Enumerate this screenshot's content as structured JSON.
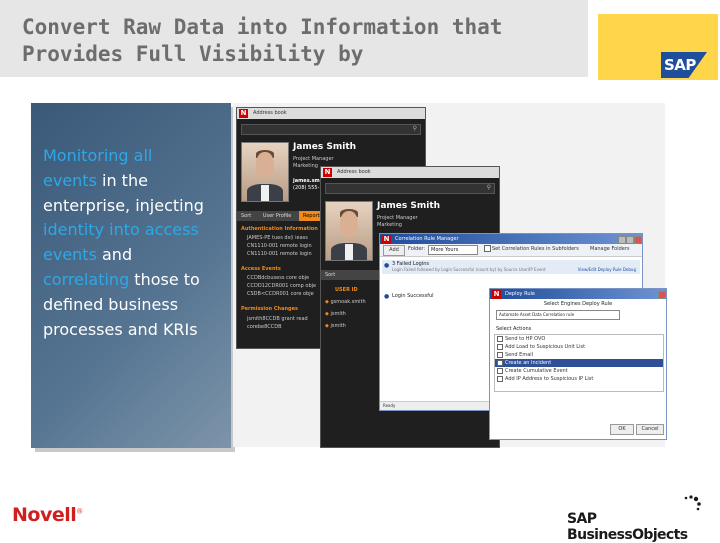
{
  "slide": {
    "title_lines": [
      "Convert Raw Data into Information that",
      "Provides Full Visibility by"
    ],
    "sap_logo_text": "SAP",
    "novell_logo_text": "Novell",
    "business_objects_logo_text": "SAP BusinessObjects"
  },
  "panel": {
    "segments": [
      {
        "text": "Monitoring all",
        "highlight": true
      },
      {
        "text": "events",
        "highlight": true
      },
      {
        "text": " in the enterprise, injecting ",
        "highlight": false
      },
      {
        "text": "identity into access events",
        "highlight": true
      },
      {
        "text": " and ",
        "highlight": false
      },
      {
        "text": "correlating",
        "highlight": true
      },
      {
        "text": " those to defined business processes and KRIs",
        "highlight": false
      }
    ]
  },
  "screens": {
    "addr1": {
      "window_title": "Address book",
      "person_name": "James Smith",
      "role": "Project Manager",
      "dept": "Marketing",
      "email": "james.smith",
      "phone": "(208) 555-1",
      "tab_label": "User Profile",
      "tab_sel": "Sort",
      "tab_reports": "Reports",
      "auth_heading": "Authentication Information",
      "auth_rows": [
        "JAMES-PE   tues ds(i ieass",
        "CN1110-001  remote login",
        "CN1110-001  remote login"
      ],
      "access_heading": "Access Events",
      "access_rows": [
        "CCDBdcbusess  core  obje",
        "CCDD12CDR001  comp obje",
        "CSDB<CCDR001  core obje"
      ],
      "perm_heading": "Permission Changes",
      "perm_rows": [
        "jsmith8CCDB  grant read",
        "corebe8CCDB"
      ]
    },
    "addr2": {
      "window_title": "Address book",
      "person_name": "James Smith",
      "role": "Project Manager",
      "dept": "Marketing",
      "tab_sel": "Sort",
      "user_id_label": "USER ID",
      "user_ids": [
        "gsmoak.smith",
        "jsmith",
        "jsmith"
      ]
    },
    "correlation": {
      "window_title": "Correlation Rule Manager",
      "add_label": "Add",
      "folder_label": "Folder:",
      "folder_value": "More Yours",
      "checkbox_label": "Set Correlation Rules in Subfolders",
      "manage_label": "Manage Folders",
      "rules": [
        "3 Failed Logins",
        "Login Successful"
      ],
      "rule_detail": "Login Failed followed by Login Successful (count by) by Source User/IP Event",
      "view_label": "View/Edit Deploy Rule Debug",
      "status": "Ready"
    },
    "deploy": {
      "window_title": "Deploy Rule",
      "heading": "Select Engines Deploy Rule",
      "dropdown_value": "Automate Asset Data Correlation rule",
      "actions_label": "Select Actions",
      "actions": [
        "Send to HP OVO",
        "Add Load to Suspicious Unit List",
        "Send Email",
        "Create an Incident",
        "Create Cumulative Event",
        "Add IP Address to Suspicious IP List"
      ],
      "selected_index": 3,
      "ok_label": "OK",
      "cancel_label": "Cancel"
    }
  },
  "colors": {
    "accent_blue": "#2da8e6",
    "novell_red": "#cf1f1f",
    "sap_yellow": "#ffd54a",
    "sap_blue": "#1f4e9c",
    "header_gray": "#e6e6e6"
  }
}
